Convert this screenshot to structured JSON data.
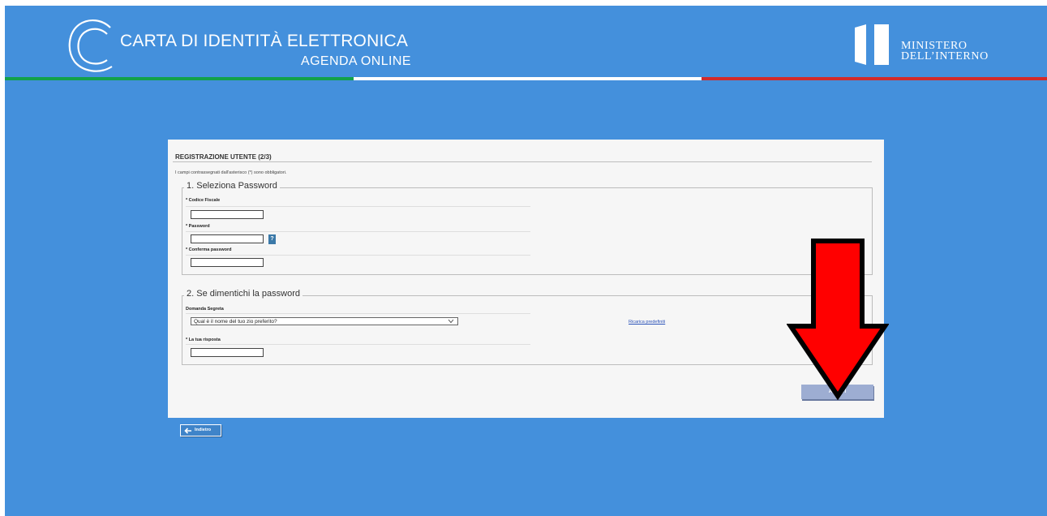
{
  "header": {
    "title": "CARTA DI IDENTITÀ ELETTRONICA",
    "subtitle": "AGENDA ONLINE",
    "ministry_line1": "MINISTERO",
    "ministry_line2": "DELL’INTERNO"
  },
  "colors": {
    "background": "#4490dc",
    "flag_green": "#12a14a",
    "flag_white": "#ffffff",
    "flag_red": "#d22b2b",
    "button": "#9dadd2",
    "annotation_arrow": "#ff0000"
  },
  "form": {
    "title": "REGISTRAZIONE UTENTE (2/3)",
    "note": "I campi contrassegnati dall'asterisco (*) sono obbligatori.",
    "section1": {
      "legend": "1. Seleziona Password",
      "fields": [
        {
          "label": "* Codice Fiscale",
          "value": ""
        },
        {
          "label": "* Password",
          "value": ""
        },
        {
          "label": "* Conferma password",
          "value": ""
        }
      ],
      "help_label": "?"
    },
    "section2": {
      "legend": "2. Se dimentichi la password",
      "question_label": "Domanda Segreta",
      "question_selected": "Qual è il nome del tuo zio preferito?",
      "reload_link": "Ricarica predefiniti",
      "answer_label": "* La tua risposta",
      "answer_value": ""
    },
    "next_button": "AVANTI"
  },
  "back_button": {
    "label": "Indietro",
    "icon": "arrow-left-icon"
  },
  "annotation": {
    "icon": "red-down-arrow-icon"
  }
}
